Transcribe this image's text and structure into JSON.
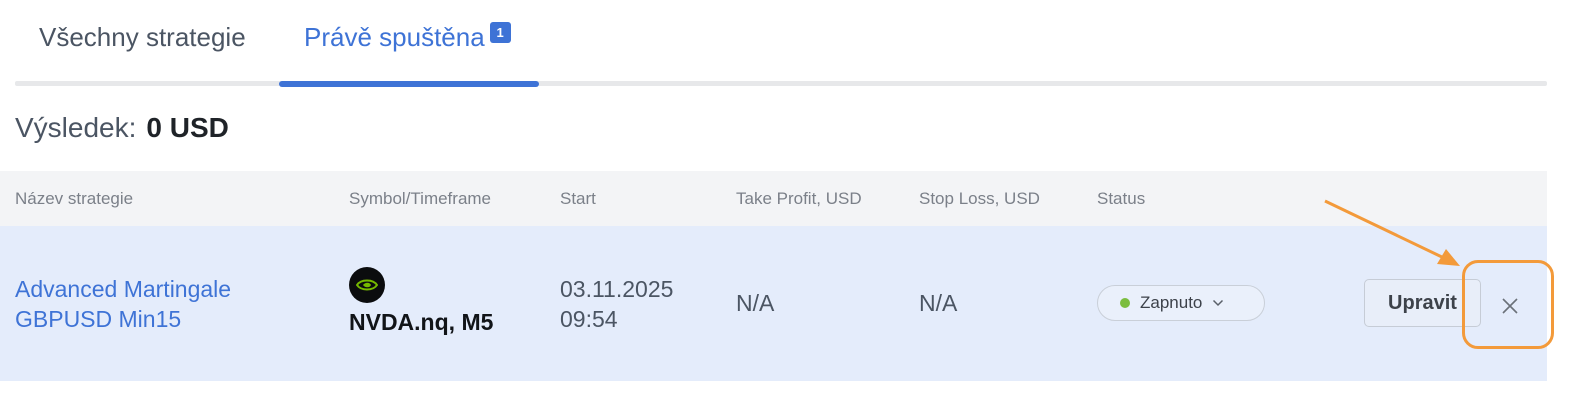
{
  "tabs": [
    {
      "label": "Všechny strategie",
      "active": false
    },
    {
      "label": "Právě spuštěna",
      "active": true,
      "badge": "1"
    }
  ],
  "result": {
    "label": "Výsledek:",
    "value": "0 USD"
  },
  "table": {
    "headers": [
      "Název strategie",
      "Symbol/Timeframe",
      "Start",
      "Take Profit, USD",
      "Stop Loss, USD",
      "Status"
    ],
    "rows": [
      {
        "name_line1": "Advanced Martingale",
        "name_line2": "GBPUSD Min15",
        "symbol_icon": "nvidia-logo-icon",
        "symbol": "NVDA.nq, M5",
        "start_date": "03.11.2025",
        "start_time": "09:54",
        "take_profit": "N/A",
        "stop_loss": "N/A",
        "status": "Zapnuto",
        "edit_label": "Upravit"
      }
    ]
  },
  "colors": {
    "accent": "#3e73d6",
    "status_on": "#7bbd3f",
    "highlight_row": "#e4ecfb",
    "annotation": "#f39a3a"
  }
}
